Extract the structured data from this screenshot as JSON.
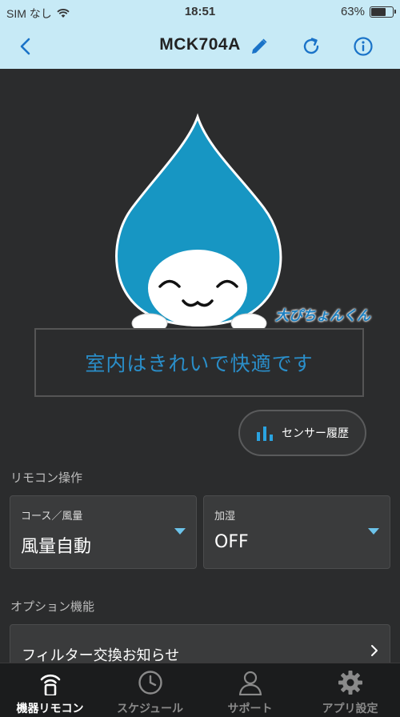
{
  "status_bar": {
    "carrier": "SIM なし",
    "time": "18:51",
    "battery": "63%"
  },
  "nav": {
    "title": "MCK704A",
    "back_icon": "chevron-left-icon",
    "edit_icon": "pencil-icon",
    "refresh_icon": "refresh-icon",
    "info_icon": "info-icon",
    "accent": "#1a73c8"
  },
  "mascot": {
    "name_text": "大ぴちょんくん"
  },
  "message": "室内はきれいで快適です",
  "sensor_button": {
    "label": "センサー履歴",
    "icon": "bar-chart-icon"
  },
  "remote": {
    "section_label": "リモコン操作",
    "course": {
      "label": "コース／風量",
      "value": "風量自動"
    },
    "humidify": {
      "label": "加湿",
      "value": "OFF"
    }
  },
  "options": {
    "section_label": "オプション機能",
    "filter_label": "フィルター交換お知らせ"
  },
  "tabs": [
    {
      "label": "機器リモコン",
      "icon": "remote-wifi-icon",
      "active": true
    },
    {
      "label": "スケジュール",
      "icon": "clock-icon",
      "active": false
    },
    {
      "label": "サポート",
      "icon": "person-icon",
      "active": false
    },
    {
      "label": "アプリ設定",
      "icon": "gear-icon",
      "active": false
    }
  ]
}
